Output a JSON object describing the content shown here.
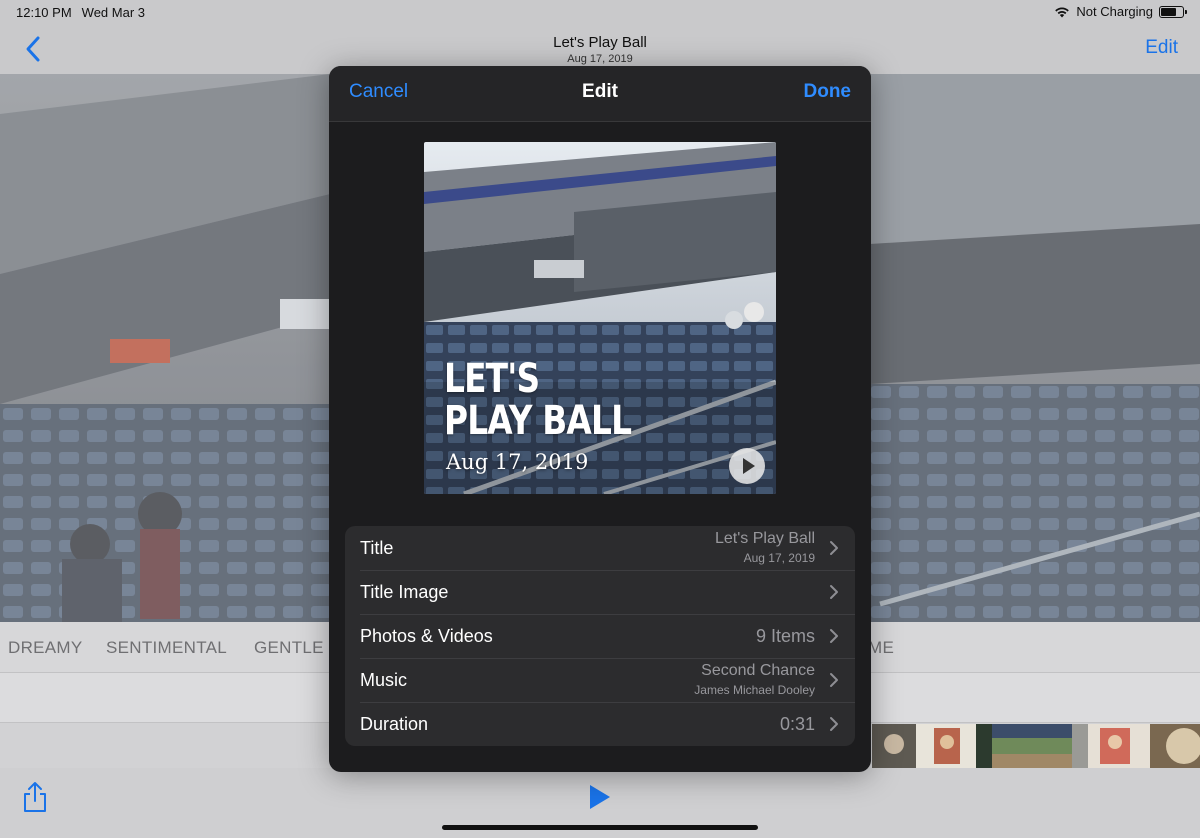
{
  "status_bar": {
    "time": "12:10 PM",
    "date": "Wed Mar 3",
    "charging": "Not Charging",
    "battery_level": 0.7
  },
  "nav": {
    "title": "Let's Play Ball",
    "subtitle": "Aug 17, 2019",
    "edit_label": "Edit",
    "back_icon": "chevron-left-icon"
  },
  "moods": [
    "DREAMY",
    "SENTIMENTAL",
    "GENTLE",
    "ME"
  ],
  "modal": {
    "cancel_label": "Cancel",
    "title": "Edit",
    "done_label": "Done",
    "preview": {
      "title_line1": "LET'S",
      "title_line2": "PLAY BALL",
      "date": "Aug 17, 2019"
    },
    "rows": {
      "title": {
        "label": "Title",
        "value": "Let's Play Ball",
        "sub": "Aug 17, 2019"
      },
      "title_image": {
        "label": "Title Image"
      },
      "photos": {
        "label": "Photos & Videos",
        "value": "9 Items"
      },
      "music": {
        "label": "Music",
        "value": "Second Chance",
        "sub": "James Michael Dooley"
      },
      "duration": {
        "label": "Duration",
        "value": "0:31"
      }
    }
  },
  "colors": {
    "accent": "#2f8cff",
    "modal_bg": "#1c1c1e",
    "row_bg": "#2c2c2e"
  }
}
